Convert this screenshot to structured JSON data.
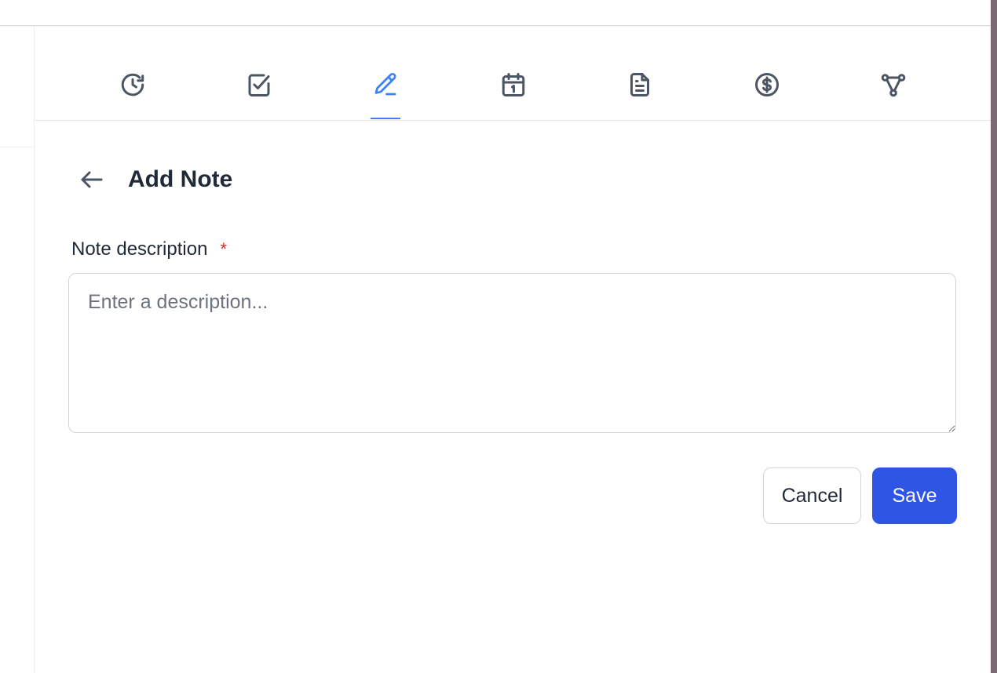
{
  "tabs": [
    {
      "icon": "history-icon",
      "active": false
    },
    {
      "icon": "checkbox-icon",
      "active": false
    },
    {
      "icon": "pencil-icon",
      "active": true
    },
    {
      "icon": "calendar-icon",
      "active": false
    },
    {
      "icon": "document-icon",
      "active": false
    },
    {
      "icon": "dollar-icon",
      "active": false
    },
    {
      "icon": "workflow-icon",
      "active": false
    }
  ],
  "header": {
    "back_icon": "arrow-left-icon",
    "title": "Add Note"
  },
  "form": {
    "description_label": "Note description",
    "required_mark": "*",
    "description_value": "",
    "description_placeholder": "Enter a description..."
  },
  "actions": {
    "cancel_label": "Cancel",
    "save_label": "Save"
  },
  "colors": {
    "accent": "#2f55e4",
    "active_tab": "#3b82f6",
    "required": "#dc2626",
    "icon": "#4b5563",
    "right_edge": "#7a6a72"
  }
}
